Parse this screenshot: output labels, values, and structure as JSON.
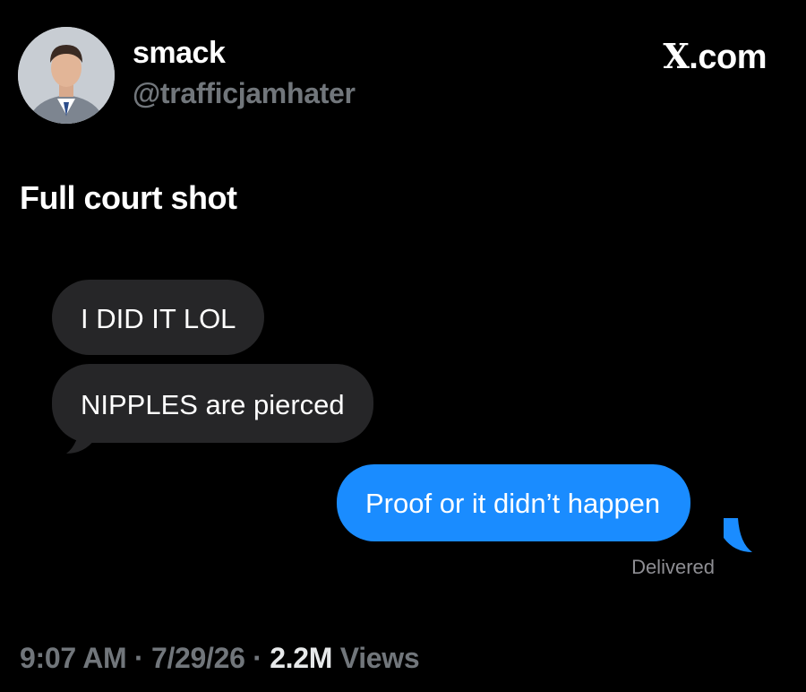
{
  "author": {
    "display_name": "smack",
    "handle": "@trafficjamhater"
  },
  "brand": {
    "logo": "X",
    "suffix": ".com"
  },
  "tweet": {
    "text": "Full court shot"
  },
  "conversation": {
    "incoming": [
      "I DID IT LOL",
      "NIPPLES are pierced"
    ],
    "outgoing": [
      "Proof or it didn’t happen"
    ],
    "status": "Delivered"
  },
  "meta": {
    "time": "9:07 AM",
    "separator": " · ",
    "date": "7/29/26",
    "views_count": "2.2M",
    "views_label": " Views"
  },
  "colors": {
    "background": "#000000",
    "incoming_bubble": "#262628",
    "outgoing_bubble": "#1a8cff",
    "secondary_text": "#71767b"
  }
}
